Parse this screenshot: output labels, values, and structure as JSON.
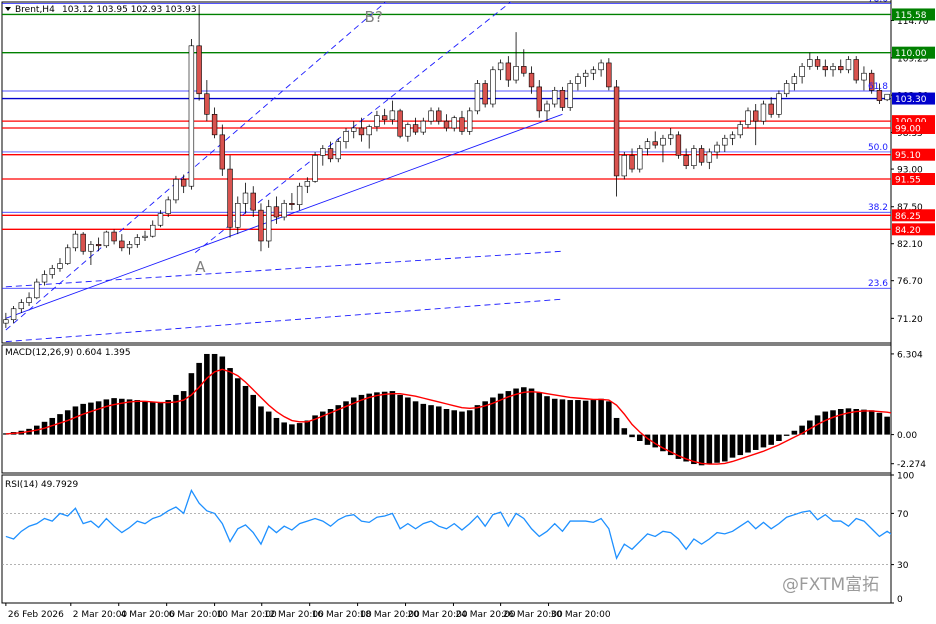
{
  "header": {
    "symbol_label": "Brent,H4",
    "ohlc_label": "103.12 103.95 102.93 103.93",
    "macd_label": "MACD(12,26,9) 0.604 1.395",
    "rsi_label": "RSI(14) 49.7929"
  },
  "watermark": {
    "text": "@FXTM富拓"
  },
  "colors": {
    "bull": "#ffffff",
    "bear": "#d9534f",
    "candle_outline": "#000000",
    "channel": "#1a1aff",
    "red_level": "#ff0000",
    "green_level": "#008000",
    "blue_level": "#0000cc",
    "macd_signal": "#ff0000",
    "rsi_line": "#1e90ff"
  },
  "annotations": [
    {
      "text": "B?",
      "x": 46.4,
      "price": 114.5
    },
    {
      "text": "A",
      "x": 24.5,
      "price": 78.0
    }
  ],
  "chart_data": [
    {
      "type": "candlestick",
      "title": "Brent,H4",
      "x_ticks": [
        {
          "label": "26 Feb 2026",
          "x": 0
        },
        {
          "label": "2 Mar 20:00",
          "x": 8.4
        },
        {
          "label": "4 Mar 20:00",
          "x": 14.6
        },
        {
          "label": "6 Mar 20:00",
          "x": 20.8
        },
        {
          "label": "10 Mar 20:00",
          "x": 27.0
        },
        {
          "label": "12 Mar 20:00",
          "x": 33.1
        },
        {
          "label": "16 Mar 20:00",
          "x": 39.3
        },
        {
          "label": "18 Mar 20:00",
          "x": 45.5
        },
        {
          "label": "20 Mar 20:00",
          "x": 51.7
        },
        {
          "label": "24 Mar 20:00",
          "x": 57.9
        },
        {
          "label": "26 Mar 20:00",
          "x": 64.0
        },
        {
          "label": "30 Mar 20:00",
          "x": 70.2
        }
      ],
      "ylim": [
        67.6,
        117.4
      ],
      "y_ticks": [
        "114.70",
        "109.25",
        "103.80",
        "98.35",
        "93.00",
        "87.50",
        "82.10",
        "76.70",
        "71.20"
      ],
      "ohlc": [
        [
          70.5,
          72.0,
          69.8,
          71.0
        ],
        [
          71.0,
          73.0,
          70.5,
          72.6
        ],
        [
          72.6,
          74.0,
          72.0,
          73.5
        ],
        [
          73.5,
          75.0,
          73.0,
          74.2
        ],
        [
          74.2,
          77.0,
          74.0,
          76.5
        ],
        [
          76.5,
          78.2,
          76.0,
          77.6
        ],
        [
          77.6,
          79.0,
          77.0,
          78.5
        ],
        [
          78.5,
          80.0,
          78.0,
          79.2
        ],
        [
          79.2,
          82.0,
          79.0,
          81.5
        ],
        [
          81.5,
          84.0,
          81.0,
          83.5
        ],
        [
          83.5,
          83.8,
          80.5,
          81.0
        ],
        [
          81.0,
          82.5,
          79.0,
          82.0
        ],
        [
          82.0,
          83.0,
          81.0,
          81.8
        ],
        [
          81.8,
          84.0,
          81.5,
          83.8
        ],
        [
          83.8,
          84.2,
          82.0,
          82.5
        ],
        [
          82.5,
          83.5,
          81.0,
          81.5
        ],
        [
          81.5,
          82.5,
          80.5,
          82.0
        ],
        [
          82.0,
          83.5,
          81.5,
          83.0
        ],
        [
          83.0,
          84.0,
          82.5,
          83.2
        ],
        [
          83.2,
          85.5,
          83.0,
          84.8
        ],
        [
          84.8,
          87.0,
          84.5,
          86.5
        ],
        [
          86.5,
          89.0,
          86.0,
          88.5
        ],
        [
          88.5,
          92.0,
          88.0,
          91.5
        ],
        [
          91.5,
          92.2,
          89.5,
          90.5
        ],
        [
          90.5,
          112.0,
          90.0,
          111.0
        ],
        [
          111.0,
          117.0,
          103.0,
          104.0
        ],
        [
          104.0,
          106.0,
          100.0,
          101.0
        ],
        [
          101.0,
          102.0,
          97.5,
          98.0
        ],
        [
          98.0,
          99.5,
          92.0,
          93.0
        ],
        [
          93.0,
          95.0,
          83.0,
          84.5
        ],
        [
          84.5,
          89.0,
          83.5,
          88.0
        ],
        [
          88.0,
          91.0,
          86.5,
          89.5
        ],
        [
          89.5,
          90.5,
          86.0,
          87.0
        ],
        [
          87.0,
          88.0,
          81.0,
          82.5
        ],
        [
          82.5,
          88.5,
          81.5,
          87.5
        ],
        [
          87.5,
          89.0,
          85.0,
          86.0
        ],
        [
          86.0,
          88.5,
          85.5,
          88.0
        ],
        [
          88.0,
          89.5,
          87.0,
          87.8
        ],
        [
          87.8,
          91.0,
          87.0,
          90.5
        ],
        [
          90.5,
          91.8,
          89.5,
          91.2
        ],
        [
          91.2,
          95.5,
          91.0,
          95.0
        ],
        [
          95.0,
          96.5,
          93.5,
          96.0
        ],
        [
          96.0,
          97.0,
          94.0,
          94.5
        ],
        [
          94.5,
          97.5,
          94.0,
          97.0
        ],
        [
          97.0,
          99.0,
          96.0,
          98.5
        ],
        [
          98.5,
          100.0,
          97.5,
          99.0
        ],
        [
          99.0,
          100.5,
          97.0,
          98.0
        ],
        [
          98.0,
          99.5,
          96.0,
          99.2
        ],
        [
          99.2,
          101.5,
          98.5,
          100.8
        ],
        [
          100.8,
          101.8,
          99.5,
          100.2
        ],
        [
          100.2,
          103.0,
          99.5,
          101.5
        ],
        [
          101.5,
          101.8,
          97.5,
          97.8
        ],
        [
          97.8,
          99.8,
          97.0,
          99.5
        ],
        [
          99.5,
          100.5,
          98.0,
          98.4
        ],
        [
          98.4,
          100.5,
          98.0,
          100.0
        ],
        [
          100.0,
          102.0,
          99.5,
          101.5
        ],
        [
          101.5,
          102.0,
          99.5,
          100.0
        ],
        [
          100.0,
          101.0,
          98.5,
          99.0
        ],
        [
          99.0,
          100.8,
          98.5,
          100.5
        ],
        [
          100.5,
          101.5,
          98.0,
          98.5
        ],
        [
          98.5,
          102.0,
          98.0,
          101.5
        ],
        [
          101.5,
          106.0,
          101.0,
          105.5
        ],
        [
          105.5,
          106.0,
          102.0,
          102.5
        ],
        [
          102.5,
          108.0,
          102.0,
          107.5
        ],
        [
          107.5,
          109.0,
          106.0,
          108.5
        ],
        [
          108.5,
          109.5,
          105.0,
          106.0
        ],
        [
          106.0,
          113.0,
          105.5,
          108.0
        ],
        [
          108.0,
          110.5,
          106.5,
          107.0
        ],
        [
          107.0,
          108.0,
          104.0,
          105.0
        ],
        [
          105.0,
          106.0,
          100.5,
          101.5
        ],
        [
          101.5,
          103.0,
          100.0,
          102.5
        ],
        [
          102.5,
          105.0,
          102.0,
          104.5
        ],
        [
          104.5,
          105.0,
          101.5,
          102.0
        ],
        [
          102.0,
          106.0,
          101.5,
          105.5
        ],
        [
          105.5,
          107.0,
          104.5,
          106.5
        ],
        [
          106.5,
          107.5,
          105.0,
          107.0
        ],
        [
          107.0,
          108.0,
          106.0,
          107.5
        ],
        [
          107.5,
          109.0,
          106.5,
          108.5
        ],
        [
          108.5,
          109.2,
          104.5,
          105.0
        ],
        [
          105.0,
          106.0,
          89.0,
          92.0
        ],
        [
          92.0,
          95.5,
          91.5,
          95.0
        ],
        [
          95.0,
          96.0,
          92.5,
          93.0
        ],
        [
          93.0,
          96.5,
          92.5,
          96.0
        ],
        [
          96.0,
          97.5,
          95.0,
          97.0
        ],
        [
          97.0,
          98.5,
          96.0,
          96.5
        ],
        [
          96.5,
          98.0,
          94.0,
          97.5
        ],
        [
          97.5,
          99.0,
          96.5,
          98.0
        ],
        [
          98.0,
          98.5,
          94.5,
          95.0
        ],
        [
          95.0,
          96.0,
          93.0,
          93.5
        ],
        [
          93.5,
          96.5,
          93.0,
          96.0
        ],
        [
          96.0,
          96.5,
          93.5,
          94.0
        ],
        [
          94.0,
          96.0,
          93.0,
          95.5
        ],
        [
          95.5,
          97.0,
          94.5,
          96.5
        ],
        [
          96.5,
          98.0,
          95.5,
          97.5
        ],
        [
          97.5,
          98.5,
          96.5,
          98.0
        ],
        [
          98.0,
          100.0,
          97.5,
          99.5
        ],
        [
          99.5,
          102.0,
          99.0,
          101.5
        ],
        [
          101.5,
          102.5,
          96.5,
          100.0
        ],
        [
          100.0,
          103.0,
          99.5,
          102.5
        ],
        [
          102.5,
          103.5,
          100.5,
          101.0
        ],
        [
          101.0,
          104.5,
          100.5,
          104.0
        ],
        [
          104.0,
          106.0,
          103.5,
          105.5
        ],
        [
          105.5,
          107.0,
          104.5,
          106.5
        ],
        [
          106.5,
          108.5,
          105.5,
          108.0
        ],
        [
          108.0,
          110.0,
          107.5,
          109.0
        ],
        [
          109.0,
          109.5,
          107.5,
          108.0
        ],
        [
          108.0,
          109.0,
          106.5,
          107.5
        ],
        [
          107.5,
          108.5,
          106.5,
          108.0
        ],
        [
          108.0,
          109.0,
          107.0,
          107.5
        ],
        [
          107.5,
          109.5,
          107.0,
          109.0
        ],
        [
          109.0,
          109.5,
          105.5,
          106.0
        ],
        [
          106.0,
          108.0,
          104.5,
          107.0
        ],
        [
          107.0,
          107.5,
          104.0,
          104.5
        ],
        [
          104.5,
          105.5,
          102.5,
          103.0
        ],
        [
          103.12,
          103.95,
          102.93,
          103.93
        ]
      ],
      "levels": [
        {
          "label": "115.58",
          "price": 115.58,
          "kind": "green"
        },
        {
          "label": "110.00",
          "price": 110.0,
          "kind": "green"
        },
        {
          "label": "103.30",
          "price": 103.3,
          "kind": "blue"
        },
        {
          "label": "100.00",
          "price": 100.0,
          "kind": "red"
        },
        {
          "label": "99.00",
          "price": 99.0,
          "kind": "red"
        },
        {
          "label": "95.10",
          "price": 95.1,
          "kind": "red"
        },
        {
          "label": "91.55",
          "price": 91.55,
          "kind": "red"
        },
        {
          "label": "86.25",
          "price": 86.25,
          "kind": "red"
        },
        {
          "label": "84.20",
          "price": 84.2,
          "kind": "red"
        }
      ],
      "fibo": [
        {
          "label": "78.6",
          "price": 117.2
        },
        {
          "label": "61.8",
          "price": 104.4
        },
        {
          "label": "50.0",
          "price": 95.5
        },
        {
          "label": "38.2",
          "price": 86.7
        },
        {
          "label": "23.6",
          "price": 75.6
        }
      ],
      "trend_lines": [
        {
          "style": "dashed",
          "from": [
            0,
            69.5
          ],
          "to": [
            72.0,
            139.7
          ]
        },
        {
          "style": "dashed",
          "from": [
            24.5,
            80.8
          ],
          "to": [
            72.0,
            123.4
          ]
        },
        {
          "style": "solid",
          "from": [
            0,
            71.2
          ],
          "to": [
            72.0,
            101.0
          ]
        },
        {
          "style": "dashed",
          "from": [
            0,
            75.8
          ],
          "to": [
            72.0,
            81.0
          ]
        },
        {
          "style": "dashed",
          "from": [
            0,
            67.8
          ],
          "to": [
            72.0,
            74.0
          ]
        }
      ]
    },
    {
      "type": "bar",
      "title": "MACD(12,26,9) 0.604 1.395",
      "ylim": [
        -3.0,
        7.0
      ],
      "y_ticks": [
        "6.304",
        "0.00",
        "-2.274"
      ],
      "histogram": [
        0.1,
        0.2,
        0.3,
        0.45,
        0.7,
        1.0,
        1.3,
        1.6,
        1.9,
        2.2,
        2.4,
        2.5,
        2.6,
        2.75,
        2.85,
        2.8,
        2.75,
        2.7,
        2.6,
        2.55,
        2.55,
        2.7,
        3.1,
        3.4,
        4.8,
        5.6,
        6.3,
        6.3,
        6.1,
        5.2,
        4.4,
        3.8,
        3.1,
        2.2,
        1.8,
        1.3,
        0.95,
        0.8,
        0.9,
        1.1,
        1.5,
        1.8,
        2.0,
        2.3,
        2.6,
        2.9,
        3.1,
        3.2,
        3.3,
        3.35,
        3.4,
        3.1,
        2.9,
        2.6,
        2.4,
        2.3,
        2.2,
        2.0,
        1.9,
        1.8,
        1.9,
        2.3,
        2.6,
        2.9,
        3.2,
        3.4,
        3.6,
        3.7,
        3.6,
        3.3,
        3.0,
        2.8,
        2.75,
        2.7,
        2.7,
        2.65,
        2.7,
        2.8,
        2.6,
        1.3,
        0.5,
        -0.2,
        -0.5,
        -0.8,
        -1.0,
        -1.3,
        -1.6,
        -1.9,
        -2.1,
        -2.3,
        -2.4,
        -2.3,
        -2.2,
        -2.1,
        -1.8,
        -1.6,
        -1.4,
        -1.2,
        -1.0,
        -0.8,
        -0.5,
        -0.1,
        0.3,
        0.7,
        1.1,
        1.5,
        1.8,
        1.9,
        2.0,
        2.05,
        2.0,
        1.95,
        1.9,
        1.7,
        1.4,
        1.1,
        0.9,
        0.7,
        0.604
      ],
      "signal": [
        0.05,
        0.1,
        0.15,
        0.25,
        0.35,
        0.5,
        0.7,
        0.9,
        1.1,
        1.35,
        1.6,
        1.8,
        2.0,
        2.2,
        2.35,
        2.45,
        2.55,
        2.6,
        2.6,
        2.55,
        2.5,
        2.5,
        2.55,
        2.7,
        3.1,
        3.7,
        4.4,
        4.9,
        5.1,
        4.9,
        4.6,
        4.1,
        3.5,
        2.9,
        2.3,
        1.8,
        1.4,
        1.1,
        1.0,
        1.0,
        1.2,
        1.45,
        1.7,
        1.95,
        2.2,
        2.45,
        2.7,
        2.9,
        3.05,
        3.15,
        3.2,
        3.2,
        3.1,
        3.0,
        2.85,
        2.7,
        2.55,
        2.4,
        2.25,
        2.1,
        2.05,
        2.1,
        2.25,
        2.45,
        2.7,
        2.95,
        3.15,
        3.3,
        3.35,
        3.3,
        3.2,
        3.1,
        3.0,
        2.9,
        2.85,
        2.8,
        2.75,
        2.75,
        2.7,
        2.3,
        1.6,
        0.8,
        0.2,
        -0.3,
        -0.7,
        -1.05,
        -1.35,
        -1.65,
        -1.9,
        -2.1,
        -2.25,
        -2.3,
        -2.3,
        -2.25,
        -2.1,
        -1.9,
        -1.7,
        -1.5,
        -1.3,
        -1.05,
        -0.8,
        -0.5,
        -0.2,
        0.1,
        0.45,
        0.8,
        1.1,
        1.35,
        1.55,
        1.7,
        1.8,
        1.85,
        1.85,
        1.8,
        1.75,
        1.65,
        1.55,
        1.45,
        1.395
      ]
    },
    {
      "type": "line",
      "title": "RSI(14) 49.7929",
      "ylim": [
        0,
        100
      ],
      "y_ticks": [
        "100",
        "70",
        "30",
        "0"
      ],
      "levels": [
        70,
        30
      ],
      "values": [
        52,
        50,
        56,
        60,
        62,
        66,
        64,
        70,
        68,
        74,
        62,
        64,
        59,
        66,
        60,
        55,
        59,
        64,
        62,
        66,
        68,
        72,
        75,
        70,
        88,
        78,
        72,
        70,
        62,
        48,
        58,
        61,
        55,
        46,
        60,
        55,
        60,
        57,
        62,
        64,
        66,
        64,
        60,
        65,
        68,
        69,
        64,
        63,
        67,
        68,
        70,
        58,
        62,
        58,
        62,
        64,
        60,
        58,
        62,
        57,
        62,
        68,
        60,
        69,
        71,
        60,
        70,
        66,
        58,
        52,
        56,
        62,
        56,
        64,
        64,
        64,
        63,
        66,
        58,
        35,
        46,
        42,
        48,
        54,
        52,
        56,
        55,
        50,
        42,
        50,
        46,
        50,
        55,
        54,
        56,
        60,
        64,
        58,
        63,
        58,
        62,
        67,
        69,
        71,
        72,
        65,
        69,
        64,
        64,
        60,
        66,
        64,
        58,
        52,
        56,
        52,
        45,
        46,
        49.79
      ]
    }
  ]
}
